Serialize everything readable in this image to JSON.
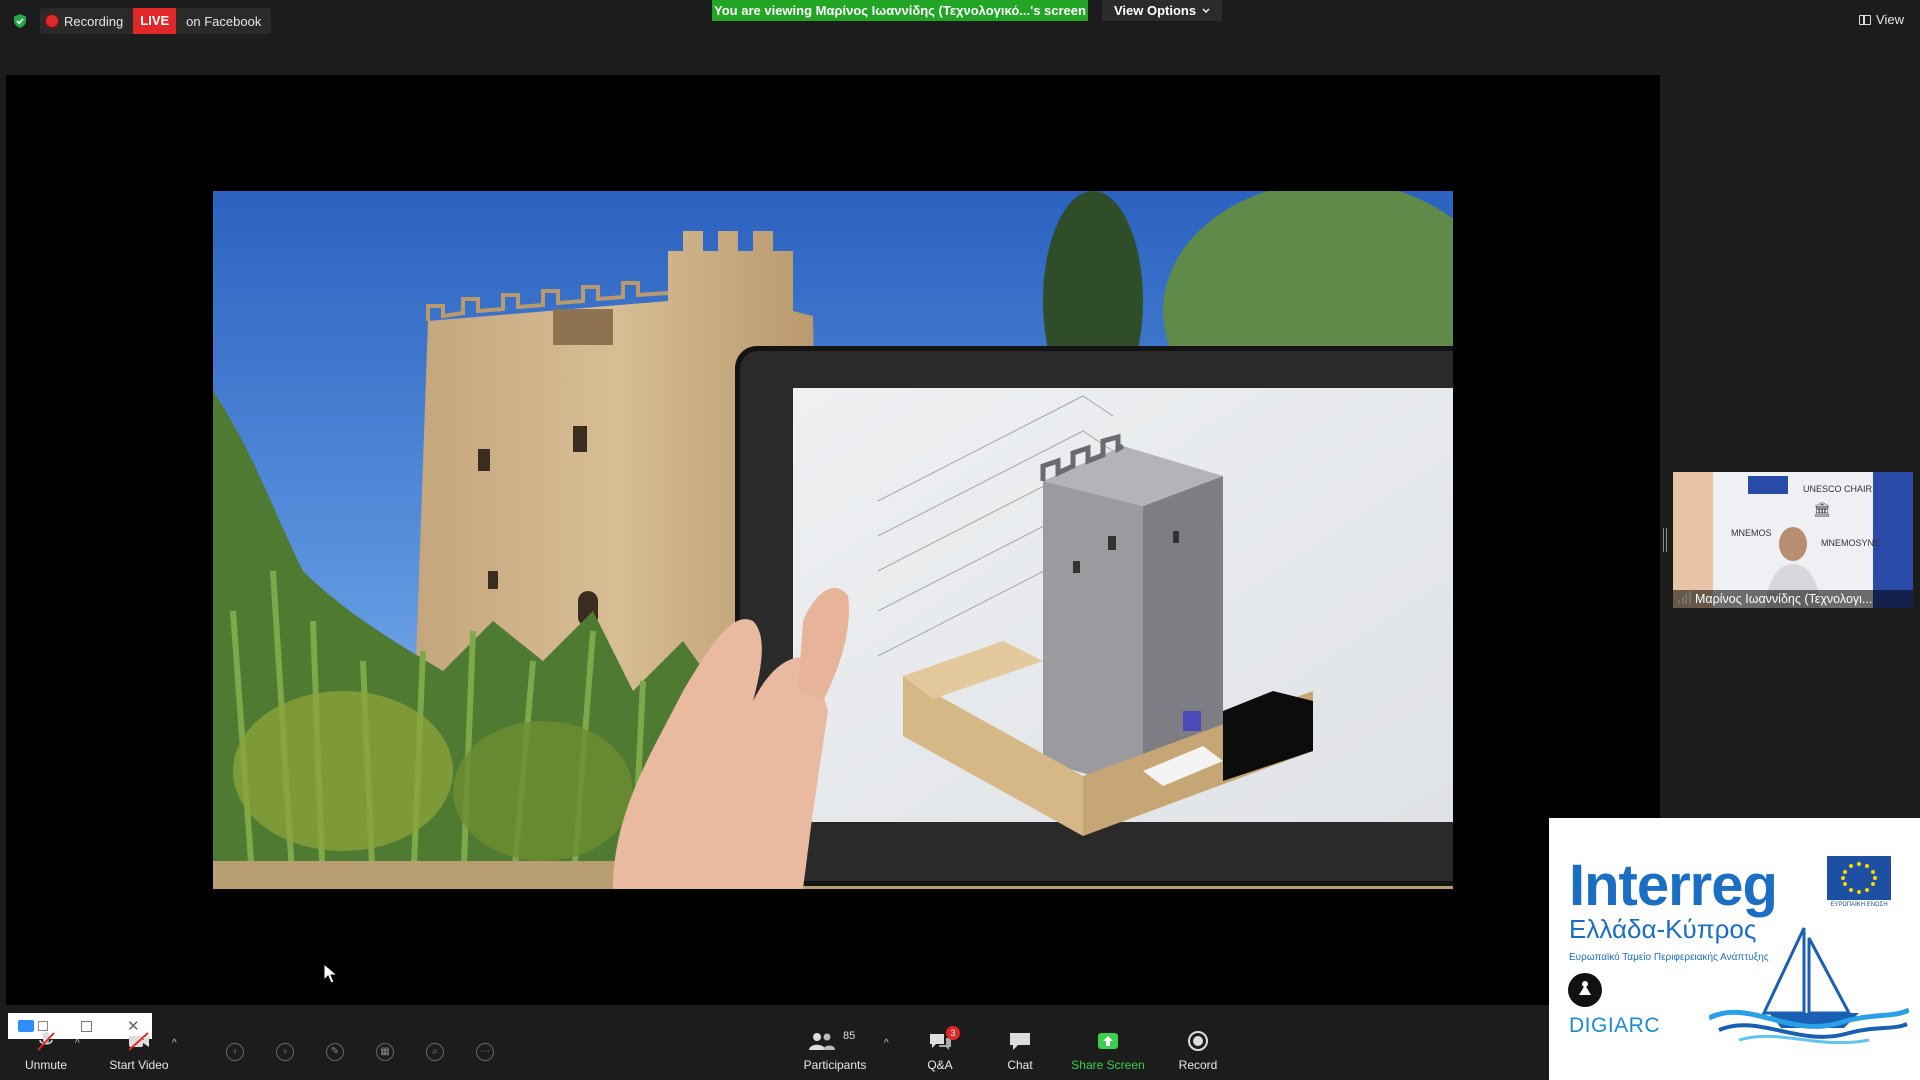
{
  "topbar": {
    "recording_label": "Recording",
    "live_badge": "LIVE",
    "live_platform": "on Facebook",
    "viewing_banner": "You are viewing Μαρίνος Ιωαννίδης (Τεχνολογικό...'s screen",
    "view_options_label": "View Options",
    "view_label": "View"
  },
  "participant_video": {
    "name": "Μαρίνος Ιωαννίδης (Τεχνολογι..."
  },
  "logo": {
    "title": "Interreg",
    "subtitle": "Ελλάδα-Κύπρος",
    "fund": "Ευρωπαϊκό Ταμείο Περιφερειακής Ανάπτυξης",
    "eu_caption": "ΕΥΡΩΠΑΪΚΗ ΕΝΩΣΗ",
    "project": "DIGIARC"
  },
  "toolbar": {
    "unmute": "Unmute",
    "start_video": "Start Video",
    "participants": "Participants",
    "participants_count": "85",
    "qa": "Q&A",
    "qa_badge": "3",
    "chat": "Chat",
    "share_screen": "Share Screen",
    "record": "Record"
  },
  "colors": {
    "live_red": "#e02828",
    "banner_green": "#22a524",
    "share_green": "#3ccf4e"
  }
}
